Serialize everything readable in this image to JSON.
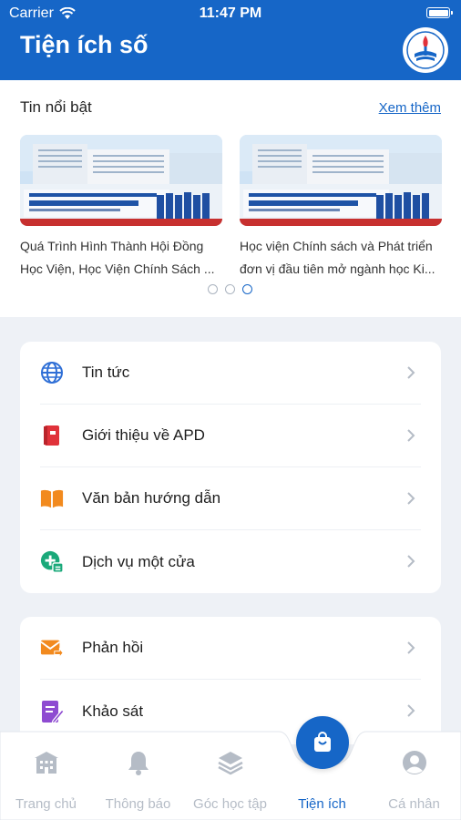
{
  "status_bar": {
    "carrier": "Carrier",
    "time": "11:47 PM"
  },
  "header": {
    "title": "Tiện ích số"
  },
  "featured": {
    "title": "Tin nổi bật",
    "more_link": "Xem thêm",
    "cards": [
      {
        "line1": "Quá Trình Hình Thành Hội Đồng",
        "line2": "Học Viện, Học Viện Chính Sách ..."
      },
      {
        "line1": "Học viện Chính sách và Phát triển",
        "line2": "đơn vị đầu tiên mở ngành học Ki..."
      }
    ],
    "pager": {
      "count": 3,
      "active_index": 2
    }
  },
  "menu_group_1": [
    {
      "label": "Tin tức",
      "icon": "globe-icon"
    },
    {
      "label": "Giới thiệu về APD",
      "icon": "flag-book-icon"
    },
    {
      "label": "Văn bản hướng dẫn",
      "icon": "open-book-icon"
    },
    {
      "label": "Dịch vụ một cửa",
      "icon": "service-add-icon"
    }
  ],
  "menu_group_2": [
    {
      "label": "Phản hồi",
      "icon": "mail-forward-icon"
    },
    {
      "label": "Khảo sát",
      "icon": "survey-edit-icon"
    }
  ],
  "tabbar": {
    "tabs": [
      {
        "label": "Trang chủ",
        "icon": "building-icon"
      },
      {
        "label": "Thông báo",
        "icon": "bell-icon"
      },
      {
        "label": "Góc học tập",
        "icon": "layers-icon"
      },
      {
        "label": "Tiện ích",
        "icon": "bag-icon"
      },
      {
        "label": "Cá nhân",
        "icon": "user-icon"
      }
    ],
    "active_index": 3
  },
  "colors": {
    "primary": "#1666c7",
    "globe": "#2f6fd6",
    "flag_book": "#e0323a",
    "open_book": "#f28a1e",
    "service": "#1aa97a",
    "mail": "#f28a1e",
    "survey": "#8e4bd1",
    "inactive_tab": "#b5bcc6"
  }
}
